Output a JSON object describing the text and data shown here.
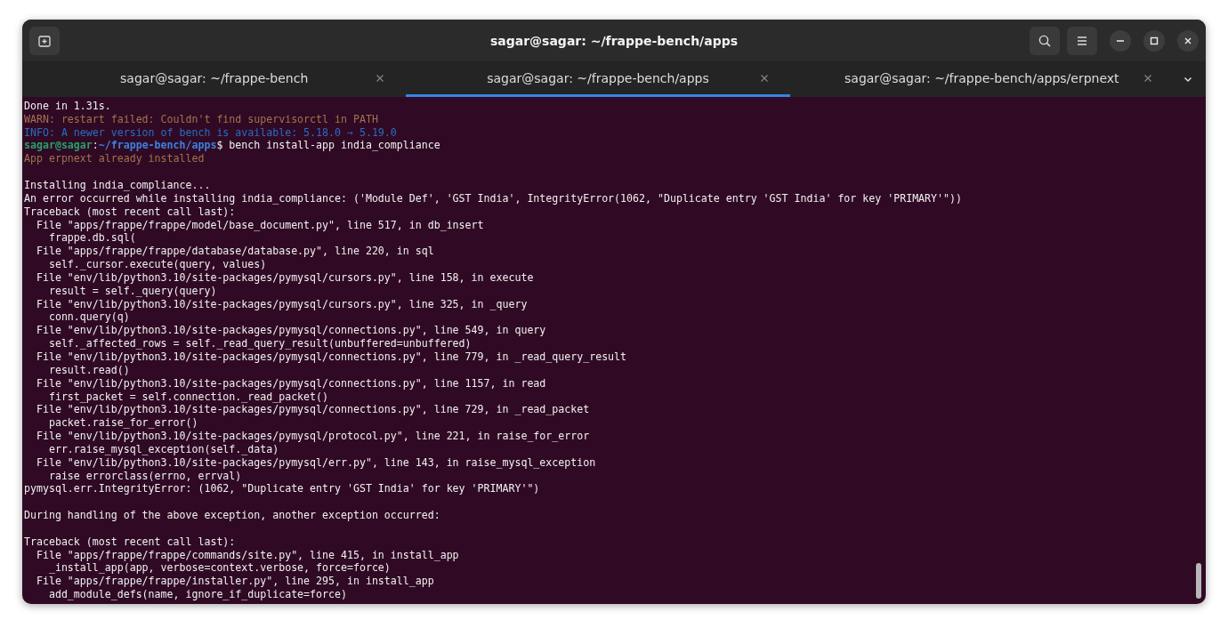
{
  "window": {
    "title": "sagar@sagar: ~/frappe-bench/apps"
  },
  "tabs": [
    {
      "label": "sagar@sagar: ~/frappe-bench",
      "selected": false
    },
    {
      "label": "sagar@sagar: ~/frappe-bench/apps",
      "selected": true
    },
    {
      "label": "sagar@sagar: ~/frappe-bench/apps/erpnext",
      "selected": false
    }
  ],
  "terminal": {
    "lines": [
      {
        "kind": "plain",
        "text": "Done in 1.31s."
      },
      {
        "kind": "warn",
        "text": "WARN: restart failed: Couldn't find supervisorctl in PATH"
      },
      {
        "kind": "info",
        "text": "INFO: A newer version of bench is available: 5.18.0 → 5.19.0"
      },
      {
        "kind": "prompt",
        "user": "sagar@sagar",
        "separator": ":",
        "path": "~/frappe-bench/apps",
        "command": "$ bench install-app india_compliance"
      },
      {
        "kind": "warn",
        "text": "App erpnext already installed"
      },
      {
        "kind": "blank"
      },
      {
        "kind": "plain",
        "text": "Installing india_compliance..."
      },
      {
        "kind": "plain",
        "text": "An error occurred while installing india_compliance: ('Module Def', 'GST India', IntegrityError(1062, \"Duplicate entry 'GST India' for key 'PRIMARY'\"))"
      },
      {
        "kind": "plain",
        "text": "Traceback (most recent call last):"
      },
      {
        "kind": "plain",
        "text": "  File \"apps/frappe/frappe/model/base_document.py\", line 517, in db_insert"
      },
      {
        "kind": "plain",
        "text": "    frappe.db.sql("
      },
      {
        "kind": "plain",
        "text": "  File \"apps/frappe/frappe/database/database.py\", line 220, in sql"
      },
      {
        "kind": "plain",
        "text": "    self._cursor.execute(query, values)"
      },
      {
        "kind": "plain",
        "text": "  File \"env/lib/python3.10/site-packages/pymysql/cursors.py\", line 158, in execute"
      },
      {
        "kind": "plain",
        "text": "    result = self._query(query)"
      },
      {
        "kind": "plain",
        "text": "  File \"env/lib/python3.10/site-packages/pymysql/cursors.py\", line 325, in _query"
      },
      {
        "kind": "plain",
        "text": "    conn.query(q)"
      },
      {
        "kind": "plain",
        "text": "  File \"env/lib/python3.10/site-packages/pymysql/connections.py\", line 549, in query"
      },
      {
        "kind": "plain",
        "text": "    self._affected_rows = self._read_query_result(unbuffered=unbuffered)"
      },
      {
        "kind": "plain",
        "text": "  File \"env/lib/python3.10/site-packages/pymysql/connections.py\", line 779, in _read_query_result"
      },
      {
        "kind": "plain",
        "text": "    result.read()"
      },
      {
        "kind": "plain",
        "text": "  File \"env/lib/python3.10/site-packages/pymysql/connections.py\", line 1157, in read"
      },
      {
        "kind": "plain",
        "text": "    first_packet = self.connection._read_packet()"
      },
      {
        "kind": "plain",
        "text": "  File \"env/lib/python3.10/site-packages/pymysql/connections.py\", line 729, in _read_packet"
      },
      {
        "kind": "plain",
        "text": "    packet.raise_for_error()"
      },
      {
        "kind": "plain",
        "text": "  File \"env/lib/python3.10/site-packages/pymysql/protocol.py\", line 221, in raise_for_error"
      },
      {
        "kind": "plain",
        "text": "    err.raise_mysql_exception(self._data)"
      },
      {
        "kind": "plain",
        "text": "  File \"env/lib/python3.10/site-packages/pymysql/err.py\", line 143, in raise_mysql_exception"
      },
      {
        "kind": "plain",
        "text": "    raise errorclass(errno, errval)"
      },
      {
        "kind": "plain",
        "text": "pymysql.err.IntegrityError: (1062, \"Duplicate entry 'GST India' for key 'PRIMARY'\")"
      },
      {
        "kind": "blank"
      },
      {
        "kind": "plain",
        "text": "During handling of the above exception, another exception occurred:"
      },
      {
        "kind": "blank"
      },
      {
        "kind": "plain",
        "text": "Traceback (most recent call last):"
      },
      {
        "kind": "plain",
        "text": "  File \"apps/frappe/frappe/commands/site.py\", line 415, in install_app"
      },
      {
        "kind": "plain",
        "text": "    _install_app(app, verbose=context.verbose, force=force)"
      },
      {
        "kind": "plain",
        "text": "  File \"apps/frappe/frappe/installer.py\", line 295, in install_app"
      },
      {
        "kind": "plain",
        "text": "    add_module_defs(name, ignore_if_duplicate=force)"
      }
    ]
  }
}
